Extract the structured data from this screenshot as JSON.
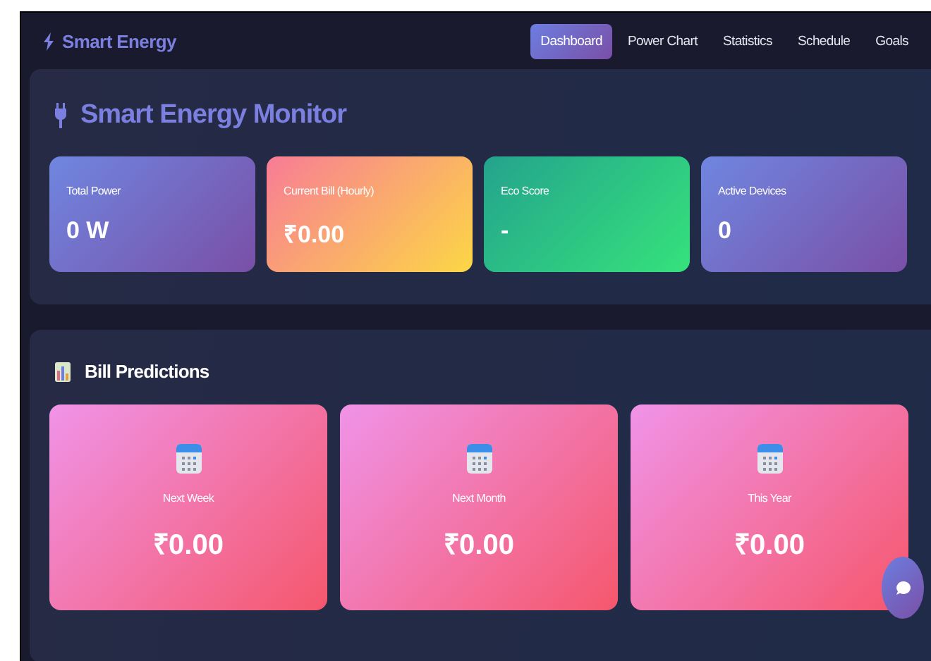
{
  "brand": "Smart Energy",
  "nav": [
    {
      "label": "Dashboard",
      "selected": true
    },
    {
      "label": "Power Chart",
      "selected": false
    },
    {
      "label": "Statistics",
      "selected": false
    },
    {
      "label": "Schedule",
      "selected": false
    },
    {
      "label": "Goals",
      "selected": false
    }
  ],
  "monitor": {
    "title": "Smart Energy Monitor",
    "stats": [
      {
        "label": "Total Power",
        "value": "0 W"
      },
      {
        "label": "Current Bill (Hourly)",
        "value": "₹0.00"
      },
      {
        "label": "Eco Score",
        "value": "-"
      },
      {
        "label": "Active Devices",
        "value": "0"
      }
    ]
  },
  "predictions": {
    "title": "Bill Predictions",
    "cards": [
      {
        "label": "Next Week",
        "value": "₹0.00"
      },
      {
        "label": "Next Month",
        "value": "₹0.00"
      },
      {
        "label": "This Year",
        "value": "₹0.00"
      }
    ]
  }
}
